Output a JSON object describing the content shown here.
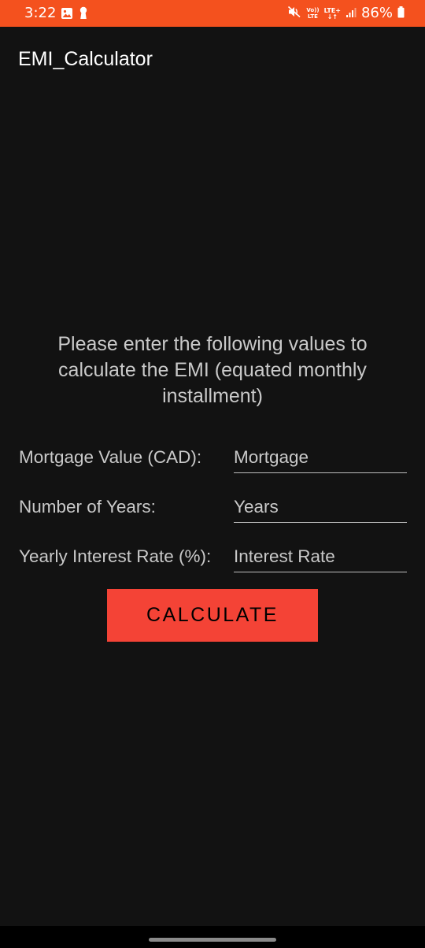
{
  "status_bar": {
    "time": "3:22",
    "battery_percent": "86%",
    "volte_top": "Vo))",
    "volte_bottom": "LTE",
    "network": "LTE+",
    "background_color": "#f4511e",
    "icons": [
      "gallery-icon",
      "keyhole-icon",
      "mute-icon",
      "volte-icon",
      "signal-icon",
      "battery-icon"
    ]
  },
  "app": {
    "title": "EMI_Calculator"
  },
  "instruction": {
    "text": "Please enter the following values to calculate the EMI (equated monthly installment)"
  },
  "form": {
    "mortgage": {
      "label": "Mortgage Value (CAD):",
      "placeholder": "Mortgage",
      "value": ""
    },
    "years": {
      "label": "Number of Years:",
      "placeholder": "Years",
      "value": ""
    },
    "interest": {
      "label": "Yearly Interest Rate (%):",
      "placeholder": "Interest Rate",
      "value": ""
    }
  },
  "button": {
    "label": "CALCULATE",
    "color": "#f44336"
  },
  "theme": {
    "background": "#121212",
    "text": "#c9c9c9"
  }
}
